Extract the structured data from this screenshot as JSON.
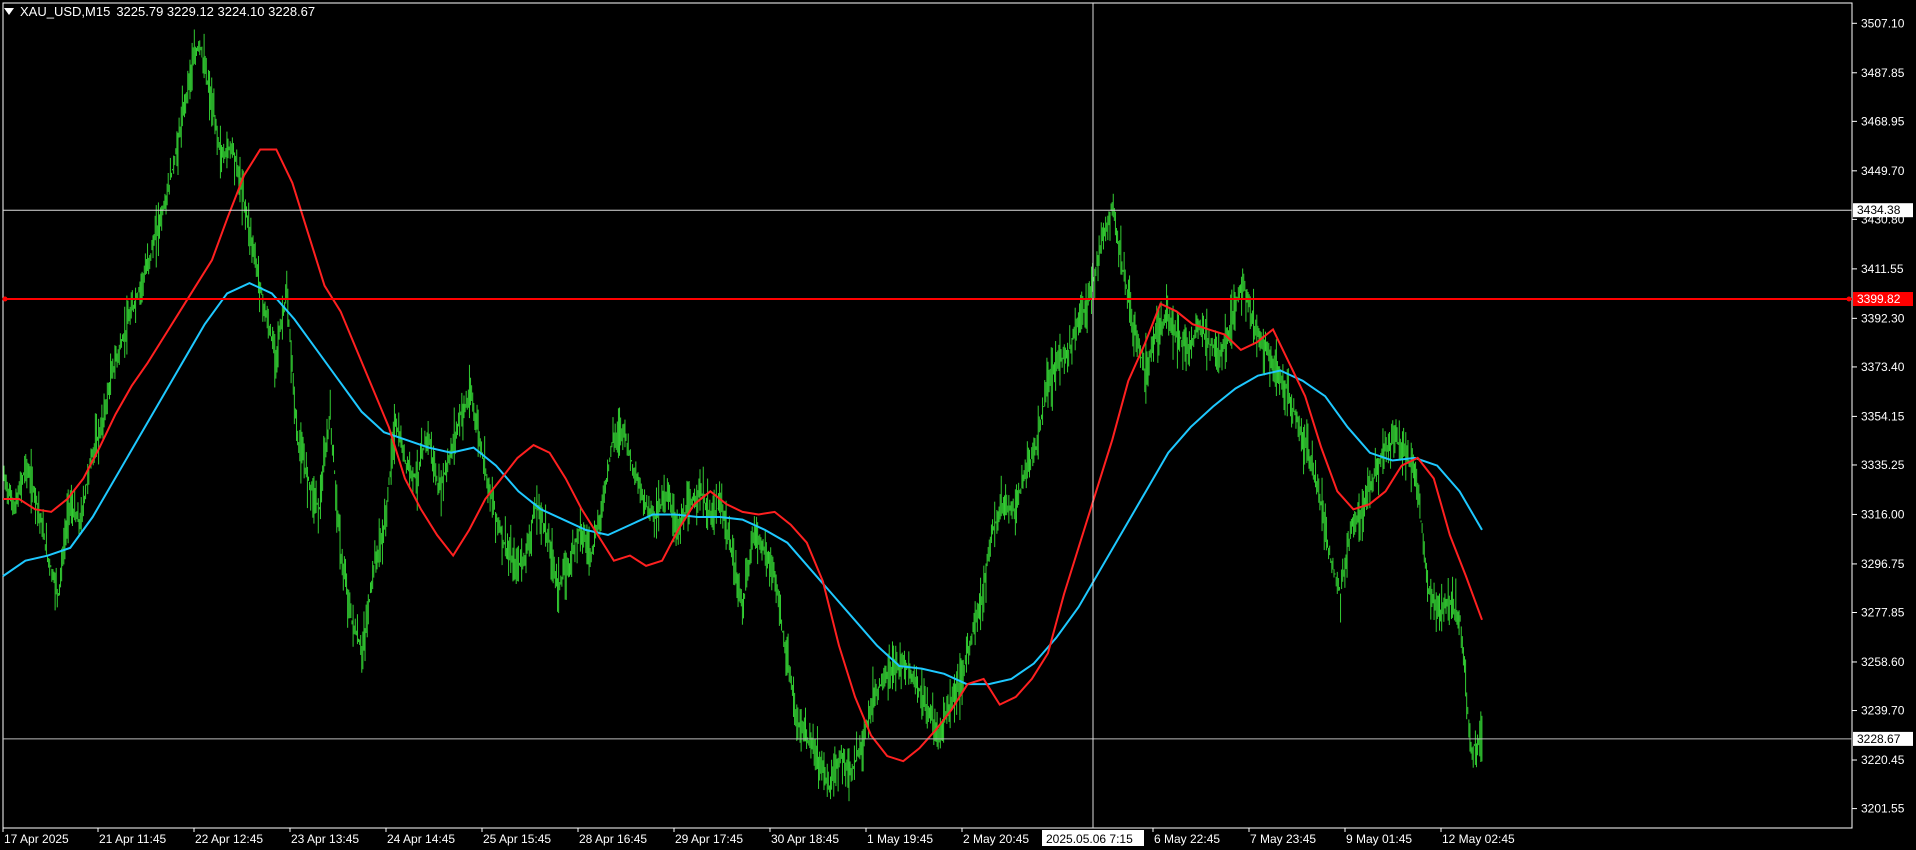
{
  "header": {
    "symbol": "XAU_USD,M15",
    "ohlc": "3225.79 3229.12 3224.10 3228.67"
  },
  "colors": {
    "background": "#000000",
    "bars": "#32cd32",
    "ma_fast": "#ff2020",
    "ma_slow": "#1ec8ff",
    "axis": "#ffffff",
    "hline_red": "#ff0000"
  },
  "chart_data": {
    "type": "line",
    "ylim": [
      3194,
      3515
    ],
    "yticks": [
      3507.1,
      3487.85,
      3468.95,
      3449.7,
      3430.8,
      3411.55,
      3392.3,
      3373.4,
      3354.15,
      3335.25,
      3316.0,
      3296.75,
      3277.85,
      3258.6,
      3239.7,
      3220.45,
      3201.55
    ],
    "xlabels": [
      "17 Apr 2025",
      "21 Apr 11:45",
      "22 Apr 12:45",
      "23 Apr 13:45",
      "24 Apr 14:45",
      "25 Apr 15:45",
      "28 Apr 16:45",
      "29 Apr 17:45",
      "30 Apr 18:45",
      "1 May 19:45",
      "2 May 20:45",
      "6 May 22:45",
      "7 May 23:45",
      "9 May 01:45",
      "12 May 02:45"
    ],
    "crosshair_time": "2025.05.06 7:15",
    "crosshair_price": "3434.38",
    "last_price": "3228.67",
    "red_line_price": "3399.82",
    "red_line_value": 3399.82,
    "crosshair_value": 3434.38,
    "last_value": 3228.67,
    "price_path": [
      3330,
      3318,
      3335,
      3322,
      3300,
      3285,
      3320,
      3312,
      3338,
      3350,
      3372,
      3385,
      3398,
      3410,
      3425,
      3440,
      3460,
      3485,
      3500,
      3478,
      3455,
      3460,
      3440,
      3418,
      3395,
      3378,
      3402,
      3345,
      3330,
      3318,
      3355,
      3300,
      3275,
      3262,
      3295,
      3310,
      3352,
      3336,
      3330,
      3348,
      3325,
      3338,
      3355,
      3362,
      3340,
      3320,
      3305,
      3295,
      3300,
      3320,
      3308,
      3288,
      3296,
      3312,
      3300,
      3318,
      3345,
      3350,
      3332,
      3320,
      3316,
      3325,
      3310,
      3318,
      3326,
      3315,
      3320,
      3300,
      3280,
      3310,
      3302,
      3290,
      3260,
      3235,
      3228,
      3220,
      3210,
      3222,
      3215,
      3228,
      3245,
      3252,
      3256,
      3258,
      3250,
      3240,
      3230,
      3242,
      3250,
      3268,
      3284,
      3310,
      3320,
      3318,
      3332,
      3342,
      3366,
      3375,
      3380,
      3392,
      3402,
      3422,
      3436,
      3410,
      3388,
      3372,
      3388,
      3392,
      3386,
      3380,
      3390,
      3382,
      3378,
      3392,
      3408,
      3390,
      3382,
      3372,
      3365,
      3352,
      3340,
      3325,
      3300,
      3285,
      3312,
      3318,
      3330,
      3340,
      3346,
      3338,
      3330,
      3288,
      3278,
      3282,
      3275,
      3225,
      3228
    ],
    "ma_fast_path": [
      3322,
      3322,
      3318,
      3317,
      3322,
      3330,
      3342,
      3355,
      3366,
      3375,
      3385,
      3395,
      3405,
      3415,
      3432,
      3448,
      3458,
      3458,
      3445,
      3425,
      3405,
      3395,
      3380,
      3365,
      3350,
      3330,
      3318,
      3308,
      3300,
      3310,
      3322,
      3330,
      3338,
      3343,
      3340,
      3330,
      3318,
      3308,
      3298,
      3300,
      3296,
      3298,
      3310,
      3320,
      3325,
      3320,
      3317,
      3316,
      3317,
      3312,
      3305,
      3290,
      3265,
      3245,
      3230,
      3222,
      3220,
      3225,
      3232,
      3240,
      3250,
      3252,
      3242,
      3245,
      3252,
      3262,
      3285,
      3305,
      3325,
      3345,
      3368,
      3382,
      3398,
      3395,
      3390,
      3388,
      3386,
      3380,
      3383,
      3388,
      3375,
      3362,
      3342,
      3325,
      3318,
      3320,
      3325,
      3335,
      3338,
      3330,
      3308,
      3292,
      3275
    ],
    "ma_slow_path": [
      3292,
      3298,
      3300,
      3303,
      3315,
      3330,
      3345,
      3360,
      3375,
      3390,
      3402,
      3406,
      3402,
      3392,
      3380,
      3368,
      3356,
      3348,
      3345,
      3342,
      3340,
      3342,
      3335,
      3325,
      3318,
      3314,
      3310,
      3308,
      3312,
      3316,
      3316,
      3315,
      3315,
      3314,
      3310,
      3305,
      3295,
      3285,
      3275,
      3265,
      3257,
      3256,
      3254,
      3250,
      3250,
      3252,
      3258,
      3268,
      3280,
      3295,
      3310,
      3325,
      3340,
      3350,
      3358,
      3365,
      3370,
      3372,
      3368,
      3362,
      3350,
      3340,
      3337,
      3338,
      3335,
      3325,
      3310
    ]
  }
}
